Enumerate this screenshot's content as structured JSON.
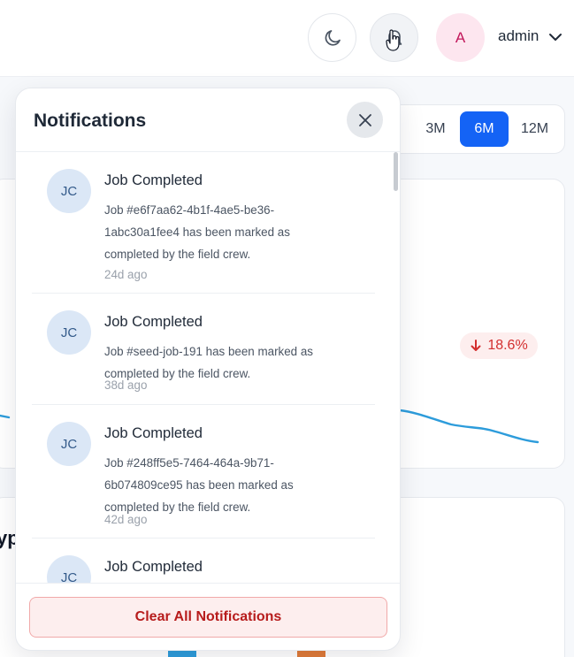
{
  "header": {
    "theme_icon": "moon-icon",
    "bell_icon": "bell-icon",
    "avatar_initial": "A",
    "user_name": "admin",
    "user_menu_icon": "chevron-down-icon"
  },
  "range_selector": {
    "options": [
      "3M",
      "6M",
      "12M"
    ],
    "selected": "6M"
  },
  "chart": {
    "trend_icon": "arrow-down-icon",
    "trend_value": "18.6%",
    "trend_color": "#d32f2f",
    "line_color": "#2d9cdb"
  },
  "bottom_card": {
    "heading_fragment": "yp"
  },
  "notifications": {
    "title": "Notifications",
    "close_icon": "close-icon",
    "items": [
      {
        "initials": "JC",
        "title": "Job Completed",
        "message": "Job #e6f7aa62-4b1f-4ae5-be36-1abc30a1fee4 has been marked as completed by the field crew.",
        "time": "24d ago"
      },
      {
        "initials": "JC",
        "title": "Job Completed",
        "message": "Job #seed-job-191 has been marked as completed by the field crew.",
        "time": "38d ago"
      },
      {
        "initials": "JC",
        "title": "Job Completed",
        "message": "Job #248ff5e5-7464-464a-9b71-6b074809ce95 has been marked as completed by the field crew.",
        "time": "42d ago"
      },
      {
        "initials": "JC",
        "title": "Job Completed"
      }
    ],
    "clear_all_label": "Clear All Notifications"
  },
  "colors": {
    "accent": "#1463f5",
    "danger": "#b71c1c",
    "avatar_bg": "#fde6ef"
  }
}
